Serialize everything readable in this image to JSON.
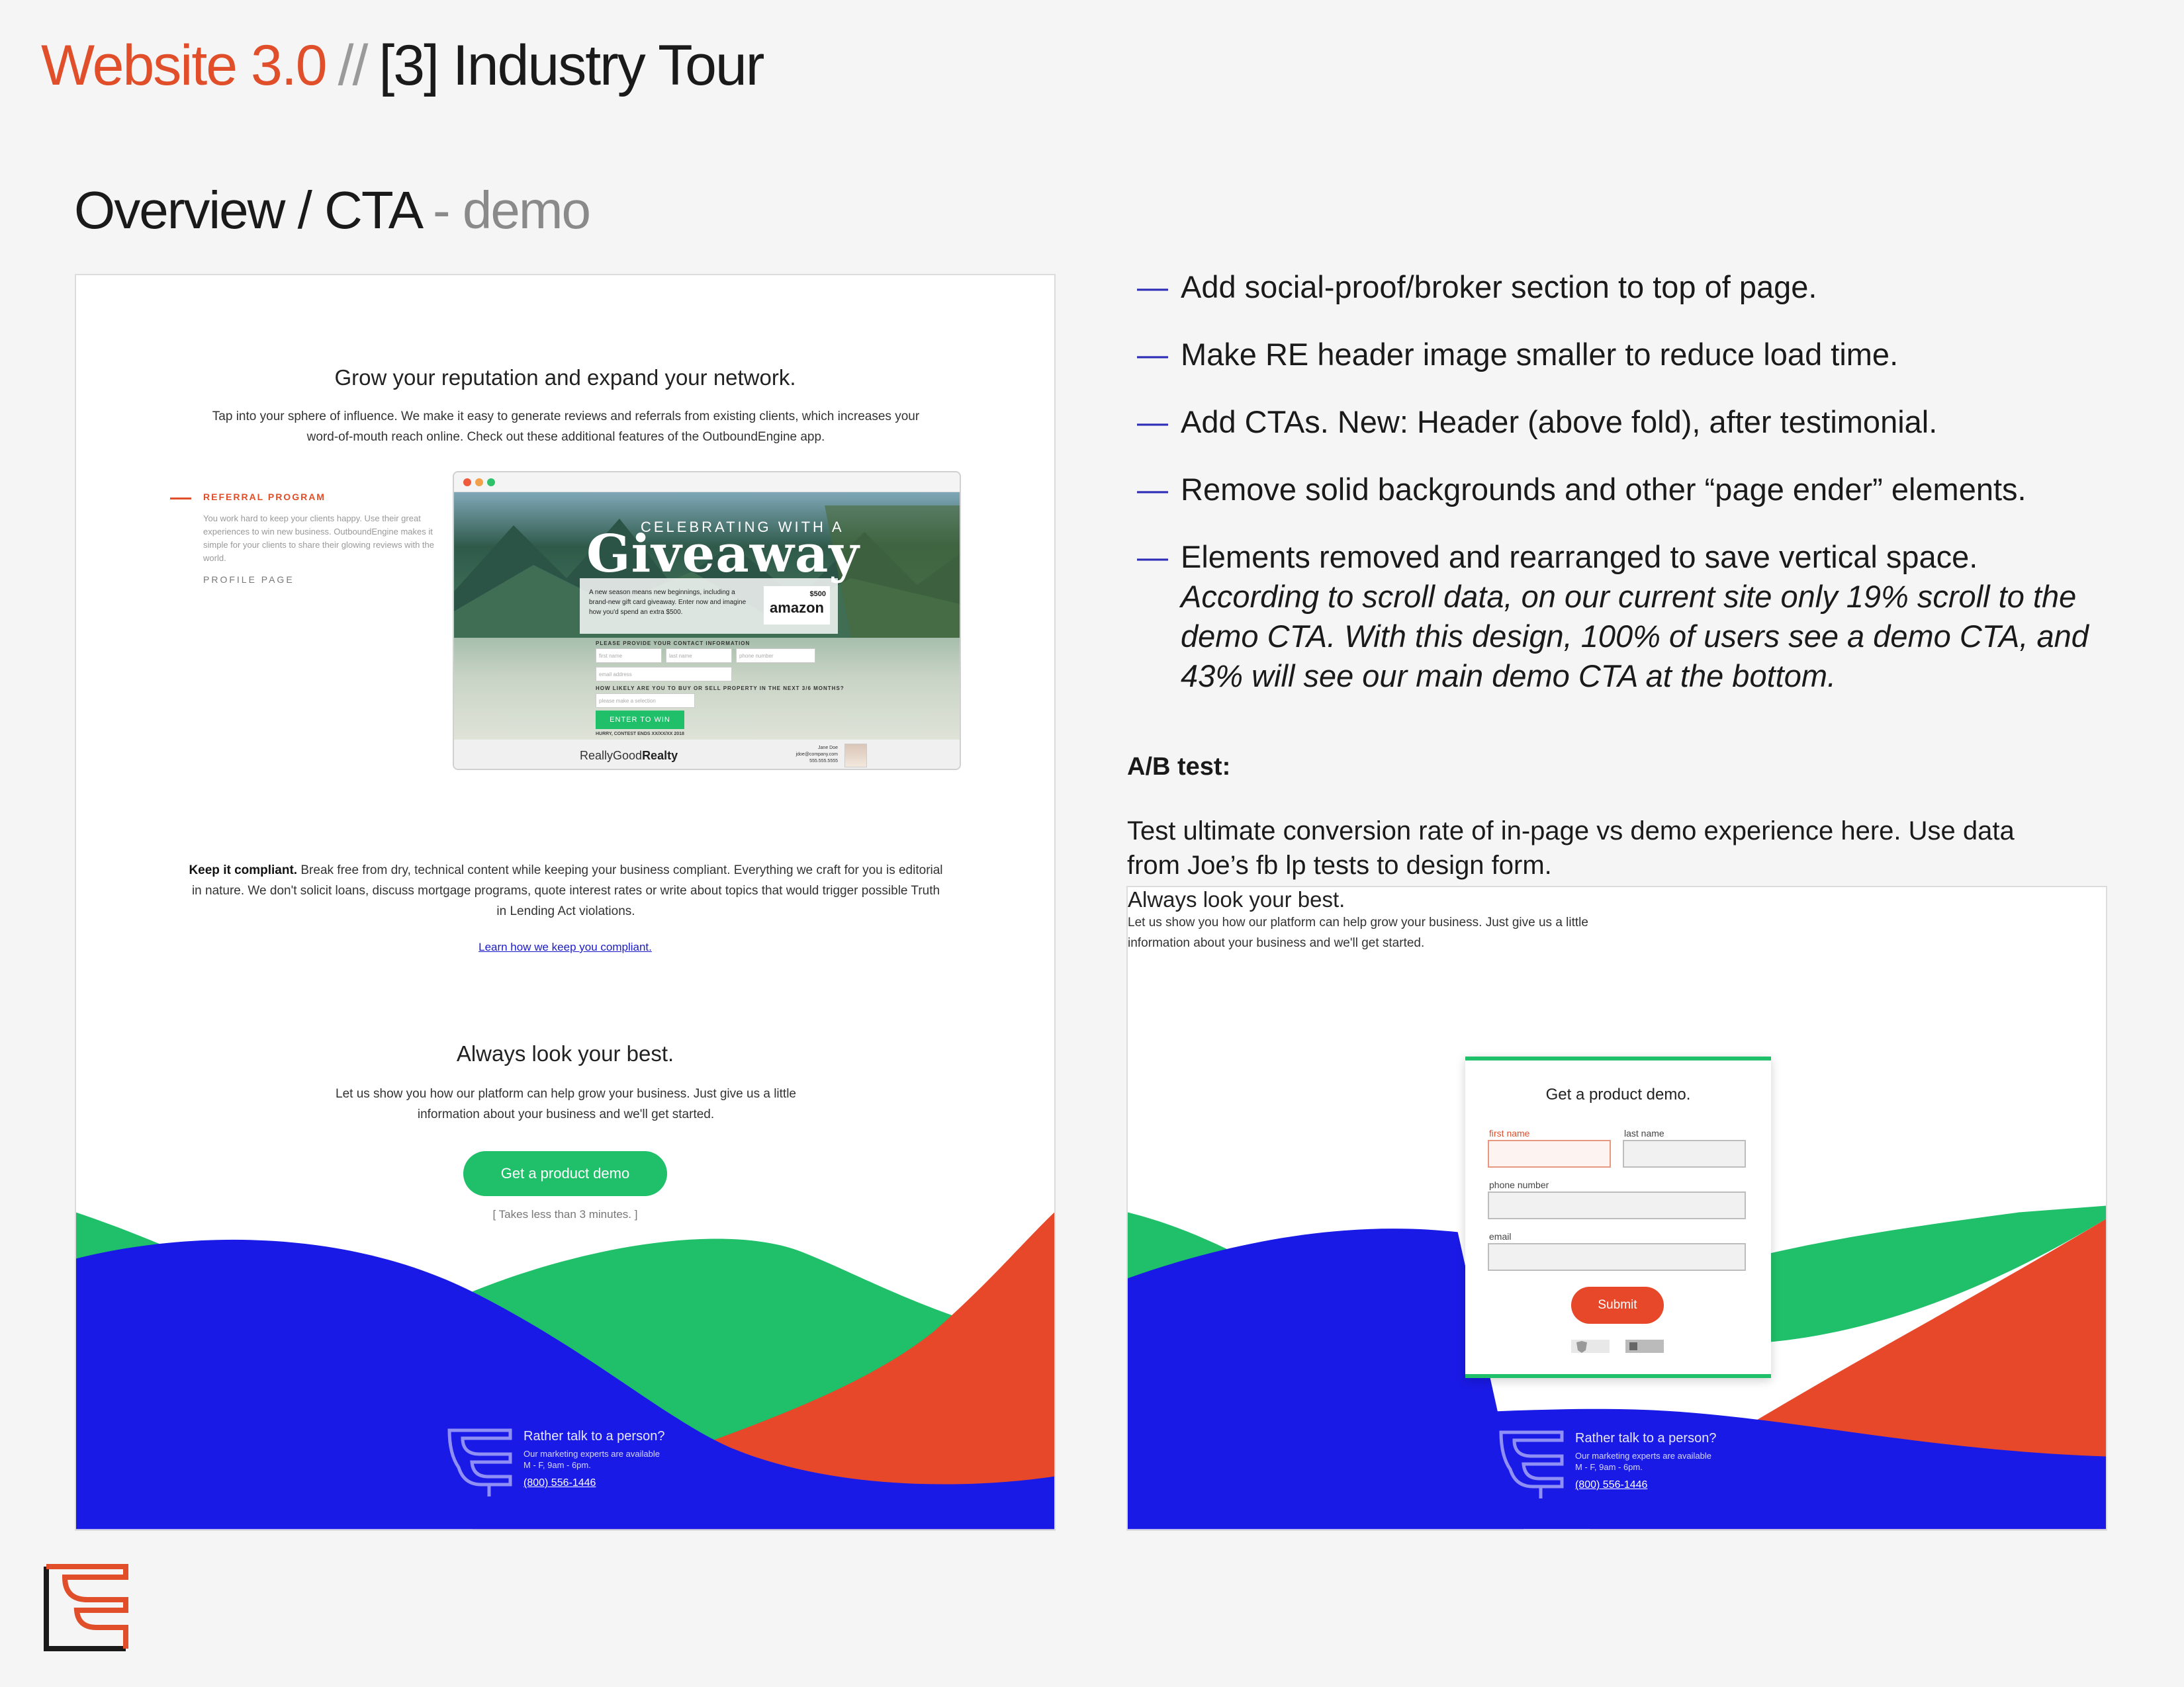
{
  "header": {
    "a": "Website 3.0",
    "sep": "//",
    "b": "[3] Industry Tour"
  },
  "subtitle": {
    "main": "Overview / CTA",
    "tail": "- demo"
  },
  "left_mock": {
    "heading": "Grow your reputation and expand your network.",
    "intro": "Tap into your sphere of influence. We make it easy to generate reviews and referrals from existing clients, which increases your word-of-mouth reach online. Check out these additional features of the OutboundEngine app.",
    "referral_title": "REFERRAL PROGRAM",
    "referral_body": "You work hard to keep your clients happy. Use their great experiences to win new business. OutboundEngine makes it simple for your clients to share their glowing reviews with the world.",
    "profile": "PROFILE PAGE",
    "giveaway": {
      "caption": "CELEBRATING WITH A",
      "title": "Giveaway",
      "text": "A new season means new beginnings, including a brand-new gift card giveaway. Enter now and imagine how you'd spend an extra $500.",
      "amount": "$500",
      "brand": "amazon",
      "contact_label": "PLEASE PROVIDE YOUR CONTACT INFORMATION",
      "first": "first name",
      "last": "last name",
      "phone": "phone number",
      "email": "email address",
      "question": "HOW LIKELY ARE YOU TO BUY OR SELL PROPERTY IN THE NEXT 3/6 MONTHS?",
      "select": "please make a selection",
      "enter": "ENTER TO WIN",
      "small": "HURRY, CONTEST ENDS XX/XX/XX 2018",
      "realty_a": "ReallyGood",
      "realty_b": "Realty",
      "agent": "Jane Doe\njdoe@company.com\n555.555.5555"
    },
    "compliant_bold": "Keep it compliant.",
    "compliant": " Break free from dry, technical content while keeping your business compliant. Everything we craft for you is editorial in nature. We don't solicit loans, discuss mortgage programs, quote interest rates or write about topics that would trigger possible Truth in Lending Act violations.",
    "learn": "Learn how we keep you compliant.",
    "heading2": "Always look your best.",
    "body2": "Let us show you how our platform can help grow your business. Just give us a little information about your business and we'll get started.",
    "cta": "Get a  product demo",
    "takes": "[ Takes less than 3 minutes. ]"
  },
  "footer": {
    "line1": "Rather talk to a person?",
    "line2": "Our marketing experts are available",
    "line3": "M - F,  9am - 6pm.",
    "phone": "(800) 556-1446"
  },
  "bullets": [
    {
      "text": "Add social-proof/broker section to top of page."
    },
    {
      "text": "Make RE header image smaller to reduce load time."
    },
    {
      "text": "Add CTAs. New: Header (above fold), after testimonial."
    },
    {
      "text": "Remove solid backgrounds and other “page ender” elements."
    },
    {
      "text": "Elements removed and rearranged to save vertical space. ",
      "italic": "According to scroll data, on our current site only 19% scroll to the demo CTA. With this design, 100% of users see a demo CTA, and 43% will see our main demo CTA at the bottom."
    }
  ],
  "dash": "—",
  "ab": {
    "title": "A/B test:",
    "body": "Test ultimate conversion rate of in-page vs demo experience here. Use data from Joe’s fb lp tests to design form."
  },
  "right_mock": {
    "heading": "Always look your best.",
    "body": "Let us show you how our platform can help grow your business. Just give us a little information about your business and we'll get started.",
    "form_title": "Get a product demo.",
    "first": "first name",
    "last": "last name",
    "phone": "phone number",
    "email": "email",
    "submit": "Submit"
  },
  "colors": {
    "orange": "#e04e2a",
    "green": "#20c06a",
    "blue": "#1a1ae6",
    "dash_blue": "#2d2db8"
  }
}
